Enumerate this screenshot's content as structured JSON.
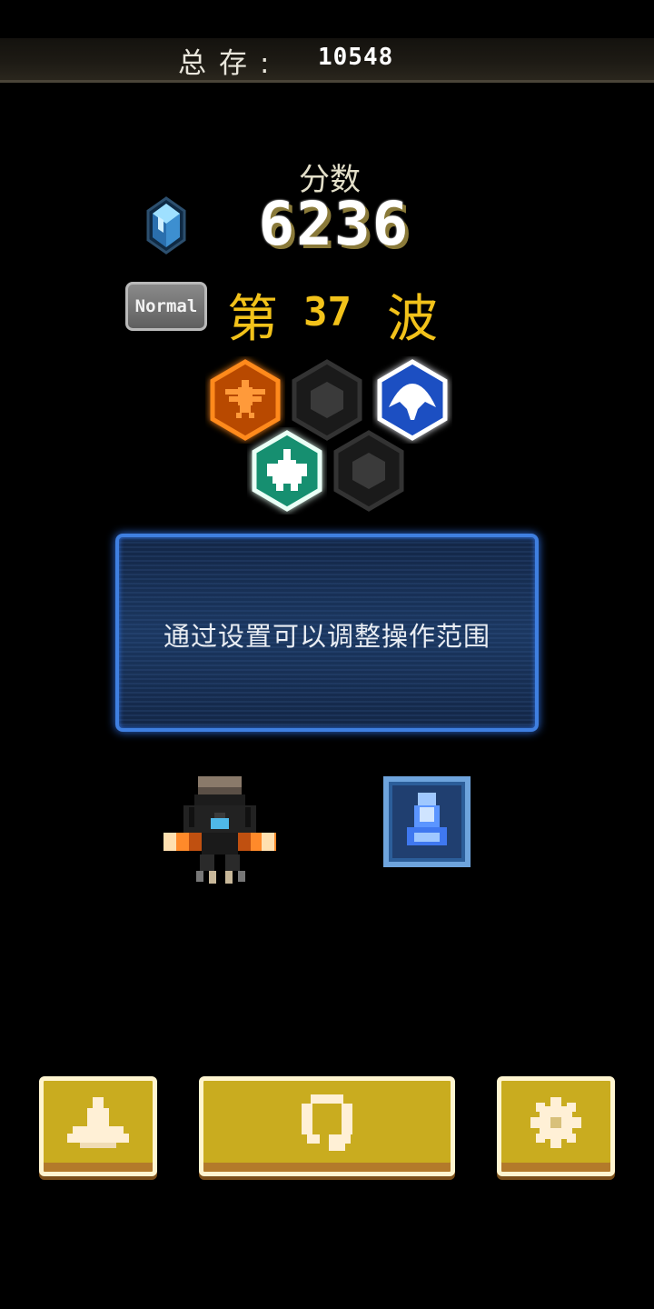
{
  "storage": {
    "label": "总存:",
    "value": "10548"
  },
  "score": {
    "label": "分数",
    "value": "6236"
  },
  "difficulty": {
    "label": "Normal"
  },
  "wave": {
    "prefix": "第",
    "number": "37",
    "suffix": "波"
  },
  "tip": {
    "text": "通过设置可以调整操作范围"
  },
  "colors": {
    "accent_gold": "#f2c21a",
    "button_fill": "#c9ac1f",
    "panel_border": "#3f7fe0",
    "hex_orange": "#ff7a10",
    "hex_blue": "#2f63e0",
    "hex_green": "#1fb08a"
  },
  "badges": [
    {
      "name": "eagle",
      "state": "active",
      "color": "orange"
    },
    {
      "name": "empty",
      "state": "locked",
      "color": "gray"
    },
    {
      "name": "manta",
      "state": "active",
      "color": "blue"
    },
    {
      "name": "fighter",
      "state": "active",
      "color": "green"
    },
    {
      "name": "empty",
      "state": "locked",
      "color": "gray"
    }
  ],
  "buttons": {
    "ship": {
      "icon": "ship-icon"
    },
    "restart": {
      "icon": "restart-icon"
    },
    "settings": {
      "icon": "gear-icon"
    }
  }
}
